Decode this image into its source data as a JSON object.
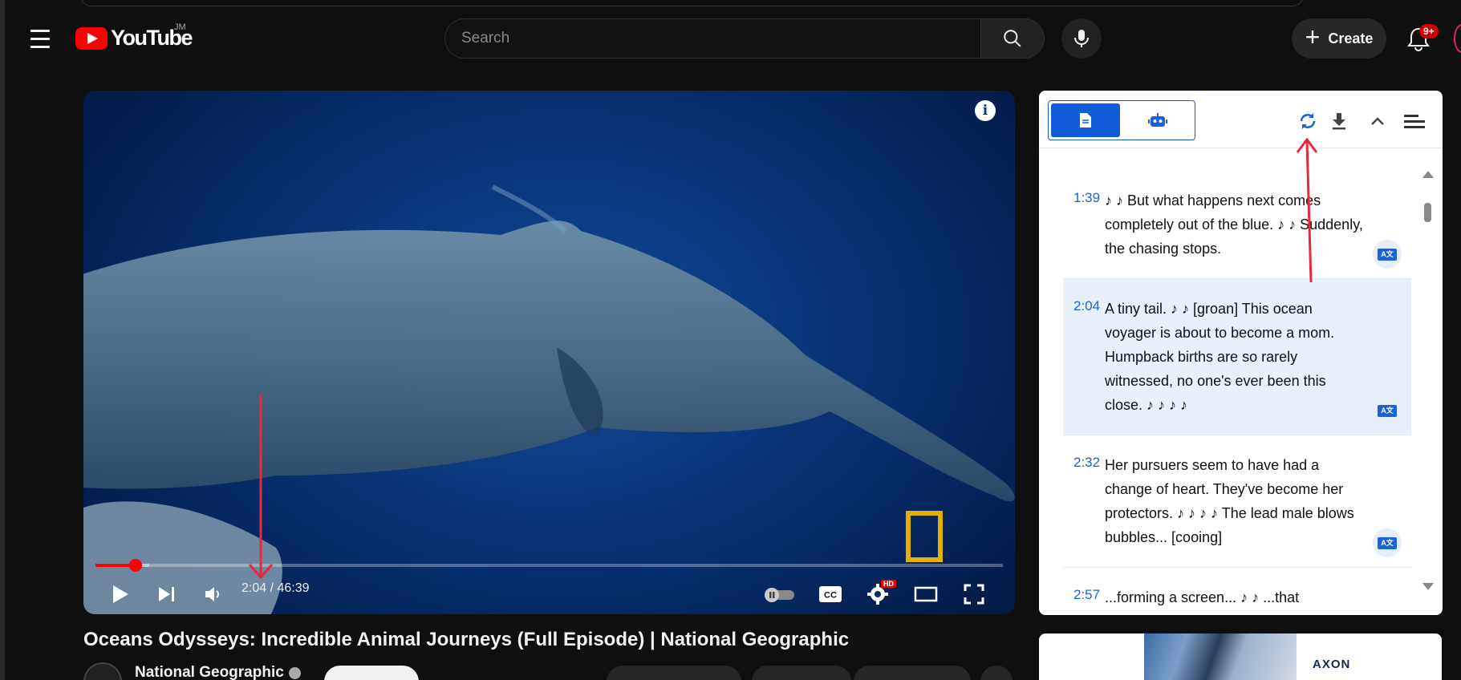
{
  "header": {
    "logo_text": "YouTube",
    "country_code": "JM",
    "search_placeholder": "Search",
    "create_label": "Create",
    "notification_count": "9+"
  },
  "player": {
    "current_time": "2:04",
    "duration": "46:39",
    "time_display": "2:04 / 46:39",
    "progress_fraction": 0.0443,
    "info_label": "i",
    "hd_badge": "HD",
    "cc_label": "CC"
  },
  "video": {
    "title": "Oceans Odysseys: Incredible Animal Journeys (Full Episode) | National Geographic",
    "channel_name": "National Geographic"
  },
  "transcript_panel": {
    "items": [
      {
        "time": "1:39",
        "text": "♪ ♪ But what happens next comes completely out of the blue. ♪ ♪ Suddenly, the chasing stops.",
        "active": false
      },
      {
        "time": "2:04",
        "text": "A tiny tail. ♪ ♪ [groan] This ocean voyager is about to become a mom. Humpback births are so rarely witnessed, no one's ever been this close. ♪ ♪ ♪ ♪",
        "active": true
      },
      {
        "time": "2:32",
        "text": "Her pursuers seem to have had a change of heart. They've become her protectors. ♪ ♪ ♪ ♪ The lead male blows bubbles... [cooing]",
        "active": false
      },
      {
        "time": "2:57",
        "text": "...forming a screen... ♪ ♪ ...that",
        "active": false
      }
    ]
  },
  "ad": {
    "brand": "AXON"
  },
  "colors": {
    "accent_blue": "#0f5bd8",
    "progress_red": "#ff0000",
    "annotation_red": "#e8283c",
    "natgeo_yellow": "#e2b100"
  }
}
